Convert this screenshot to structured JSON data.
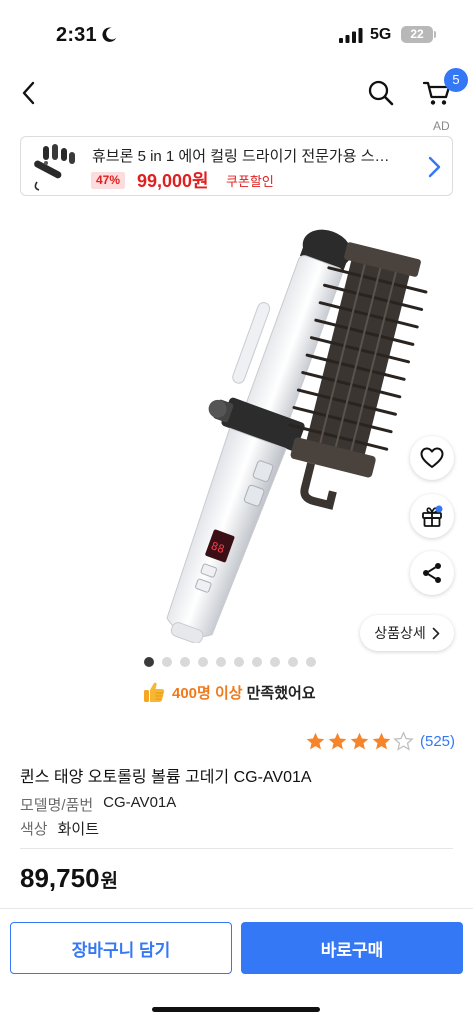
{
  "status_bar": {
    "time": "2:31",
    "network": "5G",
    "battery": "22"
  },
  "nav": {
    "cart_badge": "5"
  },
  "ad": {
    "label": "AD",
    "title": "휴브론 5 in 1 에어 컬링 드라이기 전문가용 스…",
    "discount": "47%",
    "price": "99,000원",
    "coupon": "쿠폰할인"
  },
  "actions": {
    "detail_label": "상품상세"
  },
  "carousel": {
    "total": 10,
    "active_index": 0
  },
  "satisfaction": {
    "highlight": "400명 이상",
    "rest": "만족했어요"
  },
  "rating": {
    "stars": 4,
    "max": 5,
    "review_count": "(525)"
  },
  "product": {
    "title": "퀸스 태양 오토롤링 볼륨 고데기 CG-AV01A",
    "specs": [
      {
        "label": "모델명/품번",
        "value": "CG-AV01A"
      },
      {
        "label": "색상",
        "value": "화이트"
      }
    ],
    "price": "89,750",
    "price_unit": "원"
  },
  "bottom": {
    "cart_label": "장바구니 담기",
    "buy_label": "바로구매"
  },
  "colors": {
    "accent": "#3478f6",
    "sale": "#e02020",
    "star": "#f5842a",
    "satisfaction": "#f07a1a"
  },
  "icons": [
    "moon-icon",
    "signal-icon",
    "back-icon",
    "search-icon",
    "cart-icon",
    "chevron-right-icon",
    "heart-icon",
    "gift-icon",
    "share-icon",
    "thumbs-up-icon",
    "star-icon"
  ]
}
